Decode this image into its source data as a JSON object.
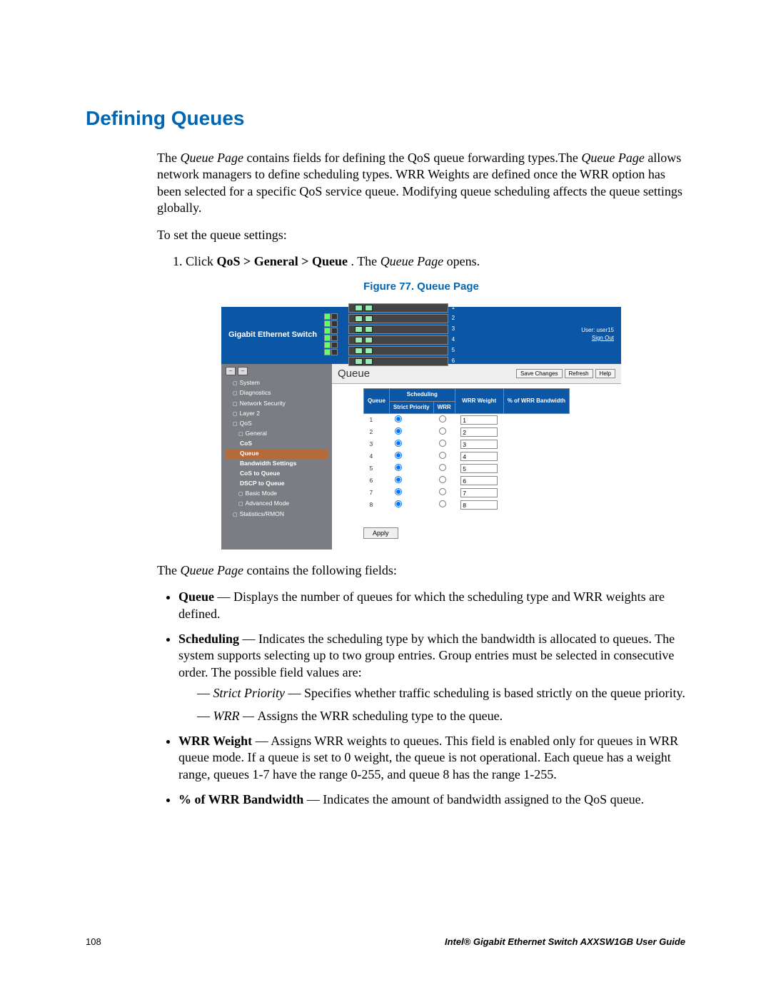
{
  "heading": "Defining Queues",
  "intro": {
    "s1a": "The ",
    "s1b": "Queue Page",
    "s1c": " contains fields for defining the QoS queue forwarding types.The ",
    "s1d": "Queue Page",
    "s1e": " allows network managers to define scheduling types. WRR Weights are defined once the WRR option has been selected for a specific QoS service queue. Modifying queue scheduling affects the queue settings globally."
  },
  "lead": "To set the queue settings:",
  "step": {
    "a": "Click ",
    "b": "QoS > General > Queue",
    "c": ". The ",
    "d": "Queue Page",
    "e": " opens."
  },
  "figCaption": "Figure 77. Queue Page",
  "shot": {
    "logo": "Gigabit Ethernet Switch",
    "user": "User: user15",
    "signout": "Sign Out",
    "nav": {
      "items": [
        "System",
        "Diagnostics",
        "Network Security",
        "Layer 2",
        "QoS",
        "General"
      ],
      "sub": [
        "CoS",
        "Queue",
        "Bandwidth Settings",
        "CoS to Queue",
        "DSCP to Queue"
      ],
      "tail": [
        "Basic Mode",
        "Advanced Mode",
        "Statistics/RMON"
      ]
    },
    "title": "Queue",
    "buttons": {
      "save": "Save Changes",
      "refresh": "Refresh",
      "help": "Help"
    },
    "tbl": {
      "h_queue": "Queue",
      "h_sched": "Scheduling",
      "h_sp": "Strict Priority",
      "h_wrr": "WRR",
      "h_wrrw": "WRR Weight",
      "h_band": "% of WRR Bandwidth",
      "rows": [
        {
          "q": "1",
          "w": "1"
        },
        {
          "q": "2",
          "w": "2"
        },
        {
          "q": "3",
          "w": "3"
        },
        {
          "q": "4",
          "w": "4"
        },
        {
          "q": "5",
          "w": "5"
        },
        {
          "q": "6",
          "w": "6"
        },
        {
          "q": "7",
          "w": "7"
        },
        {
          "q": "8",
          "w": "8"
        }
      ]
    },
    "apply": "Apply"
  },
  "fieldsLead": {
    "a": "The ",
    "b": "Queue Page",
    "c": " contains the following fields:"
  },
  "fields": {
    "queue": {
      "name": "Queue",
      "desc": " — Displays the number of queues for which the scheduling type and WRR weights are defined."
    },
    "scheduling": {
      "name": "Scheduling",
      "desc": " — Indicates the scheduling type by which the bandwidth is allocated to queues. The system supports selecting up to two group entries. Group entries must be selected in consecutive order. The possible field values are:",
      "sp": {
        "name": "Strict Priority",
        "desc": " — Specifies whether traffic scheduling is based strictly on the queue priority."
      },
      "wrr": {
        "name": "WRR — ",
        "desc": "Assigns the WRR scheduling type to the queue."
      }
    },
    "wrrw": {
      "name": "WRR Weight",
      "desc": " — Assigns WRR weights to queues. This field is enabled only for queues in WRR queue mode. If a queue is set to 0 weight, the queue is not operational. Each queue has a weight range, queues 1-7 have the range 0-255, and queue 8 has the range 1-255."
    },
    "band": {
      "name": "% of WRR Bandwidth",
      "desc": " — Indicates the amount of bandwidth assigned to the QoS queue."
    }
  },
  "footer": {
    "page": "108",
    "title": "Intel® Gigabit Ethernet Switch AXXSW1GB User Guide"
  }
}
